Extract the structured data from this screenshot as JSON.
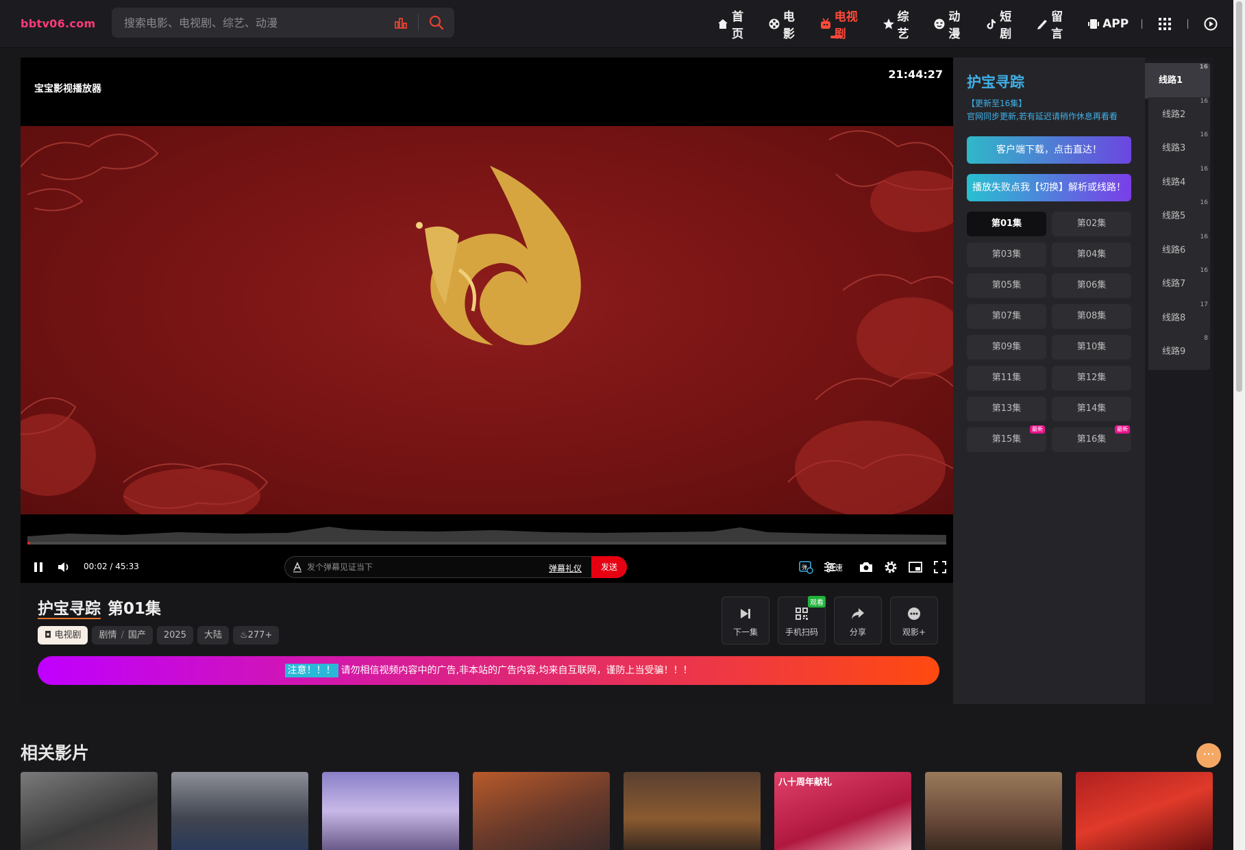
{
  "header": {
    "logo": "bbtv06.com",
    "search_placeholder": "搜索电影、电视剧、综艺、动漫",
    "nav": [
      "首页",
      "电影",
      "电视剧",
      "综艺",
      "动漫",
      "短剧",
      "留言",
      "APP"
    ]
  },
  "player": {
    "title": "宝宝影视播放器",
    "clock": "21:44:27",
    "time": "00:02 / 45:33",
    "progress": 0.001,
    "danmu_placeholder": "发个弹幕见证当下",
    "danmu_etiquette": "弹幕礼仪",
    "send": "发送",
    "speed": "倍速"
  },
  "info": {
    "name": "护宝寻踪",
    "episode": "第01集",
    "tags": {
      "category": "电视剧",
      "genre": "剧情",
      "region_type": "国产",
      "year": "2025",
      "area": "大陆",
      "heat": "277+"
    },
    "actions": [
      {
        "label": "下一集",
        "badge": ""
      },
      {
        "label": "手机扫码",
        "badge": "观看"
      },
      {
        "label": "分享",
        "badge": ""
      },
      {
        "label": "观影+",
        "badge": ""
      }
    ],
    "notice_hl": "注意！！！",
    "notice": "请勿相信视频内容中的广告,非本站的广告内容,均来自互联网，谨防上当受骗！！！"
  },
  "episodes_panel": {
    "show": "护宝寻踪",
    "update_line1": "【更新至16集】",
    "update_line2": "官网同步更新,若有延迟请稍作休息再看看",
    "download_btn": "客户端下载，点击直达！",
    "switch_btn": "播放失败点我【切换】解析或线路！",
    "episodes": [
      "第01集",
      "第02集",
      "第03集",
      "第04集",
      "第05集",
      "第06集",
      "第07集",
      "第08集",
      "第09集",
      "第10集",
      "第11集",
      "第12集",
      "第13集",
      "第14集",
      "第15集",
      "第16集"
    ],
    "new_badge": "最新"
  },
  "lines": [
    {
      "name": "线路1",
      "count": "16"
    },
    {
      "name": "线路2",
      "count": "16"
    },
    {
      "name": "线路3",
      "count": "16"
    },
    {
      "name": "线路4",
      "count": "16"
    },
    {
      "name": "线路5",
      "count": "16"
    },
    {
      "name": "线路6",
      "count": "16"
    },
    {
      "name": "线路7",
      "count": "16"
    },
    {
      "name": "线路8",
      "count": "17"
    },
    {
      "name": "线路9",
      "count": "8"
    }
  ],
  "related": {
    "title": "相关影片",
    "card_captions": [
      "",
      "",
      "",
      "",
      "",
      "八十周年献礼",
      "",
      ""
    ]
  },
  "colors": {
    "accent": "#ff4a3a",
    "logo": "#ff3a7a",
    "link": "#3fb0e8",
    "send": "#e60012"
  }
}
